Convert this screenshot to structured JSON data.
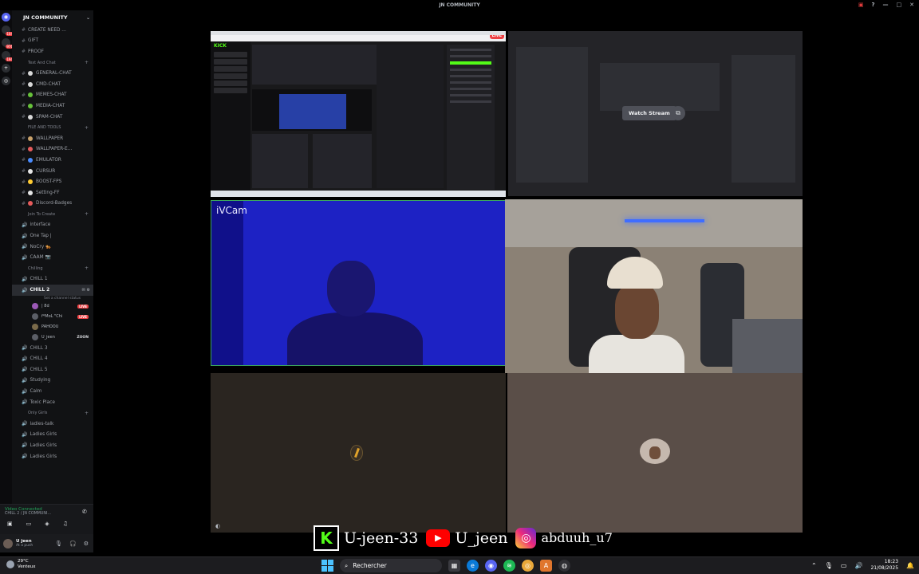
{
  "window": {
    "title": "JN COMMUNITY"
  },
  "server": {
    "name": "JN COMMUNITY",
    "badges": [
      "104",
      "976",
      "194"
    ]
  },
  "channels_top": [
    {
      "label": "CREATE NEED ..."
    },
    {
      "label": "GIFT"
    },
    {
      "label": "PROOF"
    }
  ],
  "cat_text": "Text And Chat",
  "channels_text": [
    {
      "label": "GENERAL-CHAT",
      "color": "#d8d8d8"
    },
    {
      "label": "CMD-CHAT",
      "color": "#d8d8d8"
    },
    {
      "label": "MEMES-CHAT",
      "color": "#67c23a"
    },
    {
      "label": "MEDIA-CHAT",
      "color": "#67c23a"
    },
    {
      "label": "SPAM-CHAT",
      "color": "#d8d8d8"
    }
  ],
  "cat_files": "FILE AND TOOLS",
  "channels_files": [
    {
      "label": "WALLPAPER",
      "color": "#c9a26b"
    },
    {
      "label": "WALLPAPER-E...",
      "color": "#e65b5b"
    },
    {
      "label": "EMULATOR",
      "color": "#4a8cff"
    },
    {
      "label": "CURSUR",
      "color": "#e6e6e6"
    },
    {
      "label": "BOOST-FPS",
      "color": "#ffcc33"
    },
    {
      "label": "Setting-FF",
      "color": "#e6e6e6"
    },
    {
      "label": "Discord-Badges",
      "color": "#e65b5b"
    }
  ],
  "cat_join": "Join To Create",
  "channels_join": [
    {
      "label": "interface"
    },
    {
      "label": "One Tap |"
    },
    {
      "label": "NoCry 🐅"
    },
    {
      "label": "CAAM 📷"
    }
  ],
  "cat_chilling": "Chilling",
  "channels_chill_a": [
    {
      "label": "CHILL 1"
    }
  ],
  "active_channel": {
    "label": "CHILL 2",
    "subtitle": "Set a channel status"
  },
  "voice_users": [
    {
      "name": "| 8d",
      "badge": "LIVE"
    },
    {
      "name": "f*MoL \"Chi",
      "badge": "LIVE"
    },
    {
      "name": "PAHOOU",
      "badge": ""
    },
    {
      "name": "U_jeen",
      "badge": "ZOON"
    }
  ],
  "channels_chill_b": [
    {
      "label": "CHILL 3"
    },
    {
      "label": "CHILL 4"
    },
    {
      "label": "CHILL 5"
    },
    {
      "label": "Studying"
    },
    {
      "label": "Calm"
    },
    {
      "label": "Toxic Place"
    }
  ],
  "cat_girls": "Only Girls",
  "channels_girls": [
    {
      "label": "ladies-talk"
    },
    {
      "label": "Ladies Girls"
    },
    {
      "label": "Ladies Girls"
    },
    {
      "label": "Ladies Girls"
    }
  ],
  "voice_panel": {
    "status": "Video Connected",
    "channel": "CHILL 2 / JN COMMUNI..."
  },
  "user": {
    "name": "U jeen",
    "status": "At a push"
  },
  "screen_share": {
    "live_badge": "LIVE",
    "app_logo": "KICK"
  },
  "watch": {
    "button_label": "Watch Stream"
  },
  "ivcam": {
    "label": "iVCam"
  },
  "socials": {
    "kick": "U-jeen-33",
    "youtube": "U_jeen",
    "instagram": "abduuh_u7"
  },
  "taskbar": {
    "temp": "29°C",
    "weather": "Venteux",
    "search_placeholder": "Rechercher",
    "time": "18:23",
    "date": "21/08/2025"
  }
}
